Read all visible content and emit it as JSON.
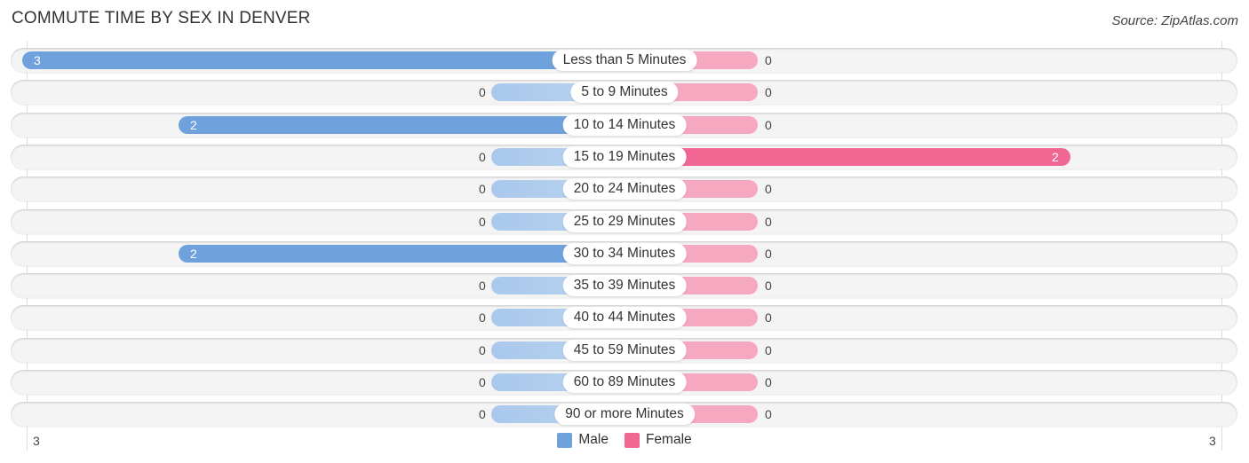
{
  "title": "COMMUTE TIME BY SEX IN DENVER",
  "source": "Source: ZipAtlas.com",
  "legend": [
    {
      "name": "Male",
      "color": "#6fa2dc"
    },
    {
      "name": "Female",
      "color": "#f06793"
    }
  ],
  "axis": {
    "left_label": "3",
    "right_label": "3"
  },
  "chart_data": {
    "type": "bar",
    "orientation": "horizontal-diverging",
    "title": "COMMUTE TIME BY SEX IN DENVER",
    "categories": [
      "Less than 5 Minutes",
      "5 to 9 Minutes",
      "10 to 14 Minutes",
      "15 to 19 Minutes",
      "20 to 24 Minutes",
      "25 to 29 Minutes",
      "30 to 34 Minutes",
      "35 to 39 Minutes",
      "40 to 44 Minutes",
      "45 to 59 Minutes",
      "60 to 89 Minutes",
      "90 or more Minutes"
    ],
    "series": [
      {
        "name": "Male",
        "color": "#6fa2dc",
        "values": [
          3,
          0,
          2,
          0,
          0,
          0,
          2,
          0,
          0,
          0,
          0,
          0
        ]
      },
      {
        "name": "Female",
        "color": "#f06793",
        "values": [
          0,
          0,
          0,
          2,
          0,
          0,
          0,
          0,
          0,
          0,
          0,
          0
        ]
      }
    ],
    "xlim": [
      3,
      3
    ],
    "x_tick_labels": [
      "3",
      "3"
    ],
    "legend_position": "bottom-center",
    "grid": false
  }
}
